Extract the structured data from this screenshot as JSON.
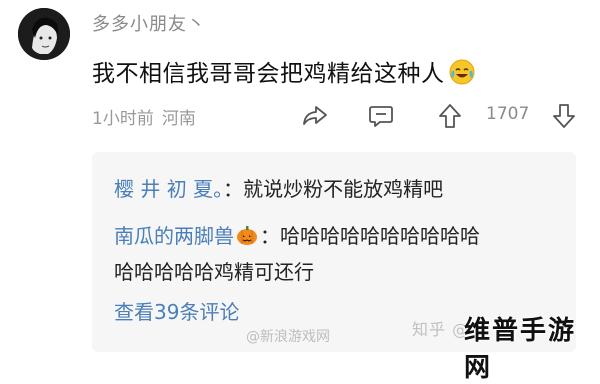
{
  "post": {
    "username": "多多小朋友丶",
    "text": "我不相信我哥哥会把鸡精给这种人",
    "emoji_icon": "laughing-crying-emoji",
    "time": "1小时前",
    "location": "河南",
    "like_count": "1707"
  },
  "icons": {
    "share": "share-arrow-icon",
    "comment": "comment-bubble-icon",
    "upvote": "upvote-arrow-icon",
    "downvote": "downvote-arrow-icon"
  },
  "replies": [
    {
      "name": "樱 井 初 夏。",
      "sep": "：",
      "text": "就说炒粉不能放鸡精吧"
    },
    {
      "name": "南瓜的两脚兽",
      "name_icon": "pumpkin-icon",
      "sep": "：",
      "text": "哈哈哈哈哈哈哈哈哈哈",
      "text_cont": "哈哈哈哈哈鸡精可还行"
    }
  ],
  "view_more": "查看39条评论",
  "watermarks": {
    "zhihu": "知乎 @吃",
    "weibo": "@新浪游戏网",
    "brand": "维普手游网"
  },
  "colors": {
    "link_blue": "#4a7fb8",
    "reply_bg": "#f6f6f6",
    "meta_gray": "#999999"
  }
}
